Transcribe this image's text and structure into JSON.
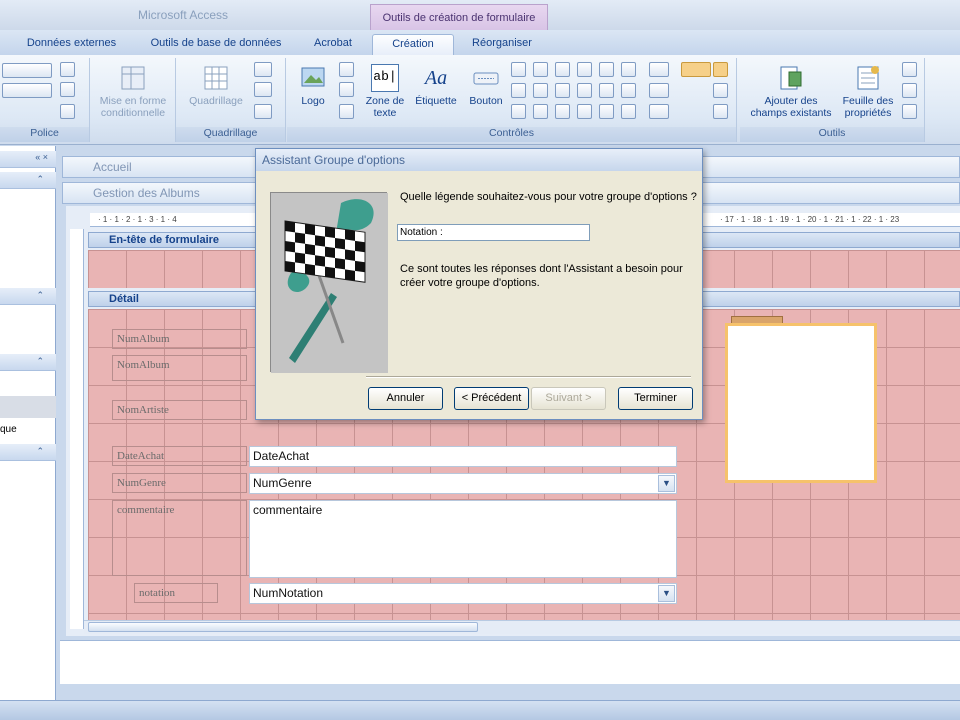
{
  "app": {
    "title": "Microsoft Access",
    "context_tool": "Outils de création de formulaire"
  },
  "tabs": [
    "Données externes",
    "Outils de base de données",
    "Acrobat",
    "Création",
    "Réorganiser"
  ],
  "active_tab": "Création",
  "ribbon": {
    "groups": {
      "police": "Police",
      "quadrillage": "Quadrillage",
      "controles": "Contrôles",
      "outils": "Outils"
    },
    "buttons": {
      "mise_en_forme": "Mise en forme conditionnelle",
      "quadrillage": "Quadrillage",
      "logo": "Logo",
      "zone_texte": "Zone de texte",
      "etiquette": "Étiquette",
      "bouton": "Bouton",
      "ajouter_champs": "Ajouter des champs existants",
      "feuille_proprietes": "Feuille des propriétés"
    },
    "glyphs": {
      "aa": "Aa",
      "abl": "ab|"
    }
  },
  "nav": {
    "item_text": "que"
  },
  "documents": {
    "tab1": "Accueil",
    "tab2": "Gestion des Albums"
  },
  "form": {
    "header_section": "En-tête de formulaire",
    "detail_section": "Détail",
    "labels": [
      "NumAlbum",
      "NomAlbum",
      "NomArtiste",
      "DateAchat",
      "NumGenre",
      "commentaire",
      "notation"
    ],
    "fields": {
      "dateachat": "DateAchat",
      "numgenre": "NumGenre",
      "commentaire": "commentaire",
      "numnotation": "NumNotation"
    },
    "ruler_left": "· 1 · 1 · 2 · 1 · 3 · 1 · 4",
    "ruler_right": "· 17 · 1 · 18 · 1 · 19 · 1 · 20 · 1 · 21 · 1 · 22 · 1 · 23"
  },
  "dialog": {
    "title": "Assistant Groupe d'options",
    "question": "Quelle légende souhaitez-vous pour votre groupe d'options ?",
    "legend_value": "Notation :",
    "info": "Ce sont toutes les réponses dont l'Assistant a besoin pour créer votre groupe d'options.",
    "buttons": {
      "annuler": "Annuler",
      "precedent": "< Précédent",
      "suivant": "Suivant >",
      "terminer": "Terminer"
    }
  },
  "colors": {
    "ribbon_text": "#15428b",
    "grid": "#e9b4b4",
    "accent": "#f6c26b"
  }
}
